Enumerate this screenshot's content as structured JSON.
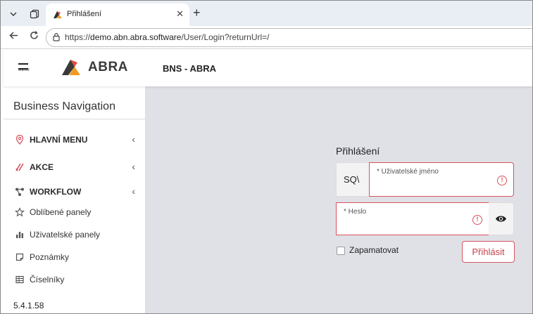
{
  "browser": {
    "tab_title": "Přihlášení",
    "url_host": "demo.abn.abra.software",
    "url_prefix": "https://",
    "url_path": "/User/Login?returnUrl=/"
  },
  "header": {
    "menu_label": "MENU",
    "logo_text": "ABRA",
    "company": "BNS - ABRA"
  },
  "sidebar": {
    "title": "Business Navigation",
    "items": [
      {
        "label": "HLAVNÍ MENU",
        "icon": "location-pin-icon"
      },
      {
        "label": "AKCE",
        "icon": "slash-icon"
      },
      {
        "label": "WORKFLOW",
        "icon": "workflow-icon"
      },
      {
        "label": "Oblíbené panely",
        "icon": "star-icon"
      },
      {
        "label": "Uživatelské panely",
        "icon": "bar-chart-icon"
      },
      {
        "label": "Poznámky",
        "icon": "note-icon"
      },
      {
        "label": "Číselníky",
        "icon": "table-icon"
      }
    ],
    "version": "5.4.1.58"
  },
  "login": {
    "title": "Přihlášení",
    "prefix": "SQ\\",
    "username_label": "* Uživatelské jméno",
    "username_value": "",
    "password_label": "* Heslo",
    "password_value": "",
    "remember_label": "Zapamatovat",
    "remember_checked": false,
    "submit_label": "Přihlásit"
  },
  "colors": {
    "accent": "#d6545e",
    "main_bg": "#dfe1e7"
  }
}
